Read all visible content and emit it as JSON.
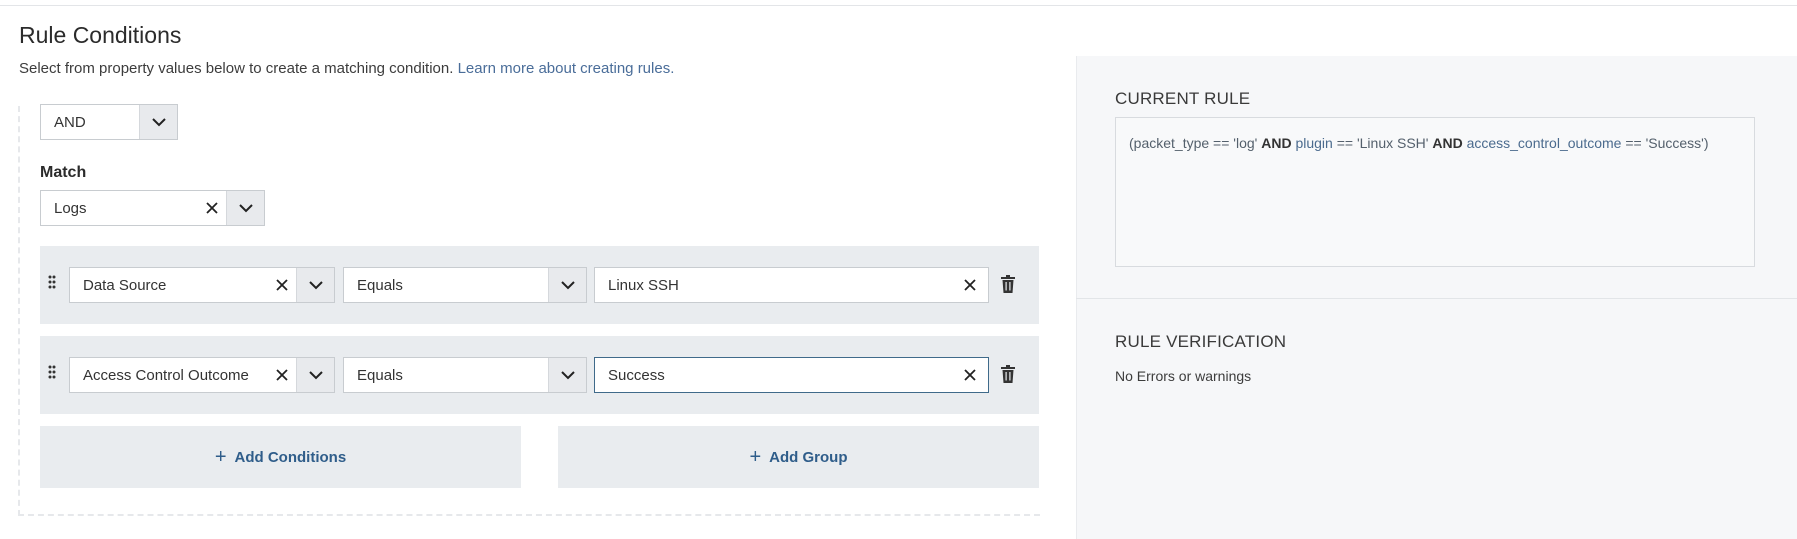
{
  "header": {
    "title": "Rule Conditions",
    "subtitle": "Select from property values below to create a matching condition.",
    "learn_more": "Learn more about creating rules."
  },
  "builder": {
    "logic_operator": "AND",
    "match_label": "Match",
    "match_value": "Logs",
    "conditions": [
      {
        "field": "Data Source",
        "operator": "Equals",
        "value": "Linux SSH"
      },
      {
        "field": "Access Control Outcome",
        "operator": "Equals",
        "value": "Success"
      }
    ],
    "add_conditions_label": "Add Conditions",
    "add_group_label": "Add Group"
  },
  "current_rule": {
    "heading": "CURRENT RULE",
    "parts": {
      "p1": "(packet_type == 'log' ",
      "and1": "AND",
      "p2a": " plugin",
      "p2b": " == 'Linux SSH' ",
      "and2": "AND",
      "p3a": " access_control_outcome",
      "p3b": " == 'Success')"
    }
  },
  "verification": {
    "heading": "RULE VERIFICATION",
    "message": "No Errors or warnings"
  },
  "colors": {
    "accent": "#2f5d8a",
    "link": "#4a6d99",
    "row_bg": "#e9ecef",
    "panel_bg": "#f6f7f9"
  },
  "icons": [
    "chevron-down-icon",
    "clear-icon",
    "drag-handle-icon",
    "trash-icon",
    "plus-icon"
  ]
}
